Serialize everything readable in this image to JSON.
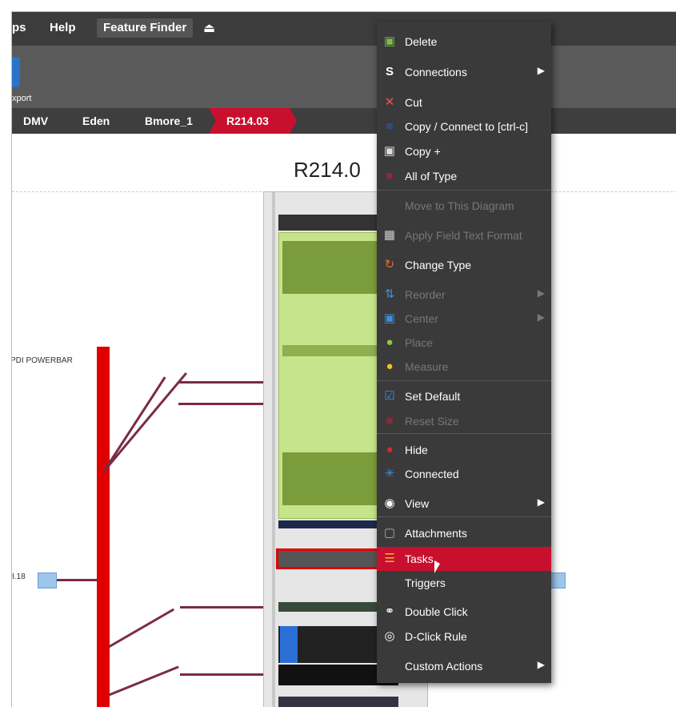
{
  "menubar": {
    "items": [
      "ps",
      "Help"
    ],
    "feature_finder": "Feature Finder",
    "eject_icon": "eject-icon"
  },
  "toolbar": {
    "label": "xport"
  },
  "breadcrumb": {
    "items": [
      "DMV",
      "Eden",
      "Bmore_1"
    ],
    "active": "R214.03"
  },
  "canvas": {
    "title": "R214.0",
    "powerbar_label": "PDI POWERBAR",
    "port_label": "I.18"
  },
  "context_menu": {
    "items": [
      {
        "label": "Delete",
        "icon": "trash-icon",
        "enabled": true
      },
      {
        "label": "Connections",
        "icon": "connections-icon",
        "enabled": true,
        "submenu": true
      },
      {
        "label": "Cut",
        "icon": "scissors-icon",
        "enabled": true
      },
      {
        "label": "Copy / Connect to [ctrl-c]",
        "icon": "copy-icon",
        "enabled": true
      },
      {
        "label": "Copy +",
        "icon": "copy-plus-icon",
        "enabled": true
      },
      {
        "label": "All of Type",
        "icon": "all-of-type-icon",
        "enabled": true
      },
      {
        "label": "Move to This Diagram",
        "icon": "",
        "enabled": false
      },
      {
        "label": "Apply Field Text Format",
        "icon": "apply-format-icon",
        "enabled": false
      },
      {
        "label": "Change Type",
        "icon": "change-type-icon",
        "enabled": true
      },
      {
        "label": "Reorder",
        "icon": "reorder-icon",
        "enabled": false,
        "submenu": true
      },
      {
        "label": "Center",
        "icon": "center-icon",
        "enabled": false,
        "submenu": true
      },
      {
        "label": "Place",
        "icon": "place-icon",
        "enabled": false
      },
      {
        "label": "Measure",
        "icon": "measure-icon",
        "enabled": false
      },
      {
        "label": "Set Default",
        "icon": "set-default-icon",
        "enabled": true
      },
      {
        "label": "Reset Size",
        "icon": "reset-size-icon",
        "enabled": false
      },
      {
        "label": "Hide",
        "icon": "hide-icon",
        "enabled": true
      },
      {
        "label": "Connected",
        "icon": "connected-icon",
        "enabled": true
      },
      {
        "label": "View",
        "icon": "eye-icon",
        "enabled": true,
        "submenu": true
      },
      {
        "label": "Attachments",
        "icon": "attachments-icon",
        "enabled": true
      },
      {
        "label": "Tasks",
        "icon": "tasks-icon",
        "enabled": true,
        "highlighted": true
      },
      {
        "label": "Triggers",
        "icon": "",
        "enabled": true
      },
      {
        "label": "Double Click",
        "icon": "double-click-icon",
        "enabled": true
      },
      {
        "label": "D-Click Rule",
        "icon": "d-click-rule-icon",
        "enabled": true
      },
      {
        "label": "Custom Actions",
        "icon": "",
        "enabled": true,
        "submenu": true
      }
    ]
  },
  "colors": {
    "accent_red": "#c8102e",
    "menu_bg": "#3a3a3a",
    "rack_green": "#c6e48b"
  }
}
